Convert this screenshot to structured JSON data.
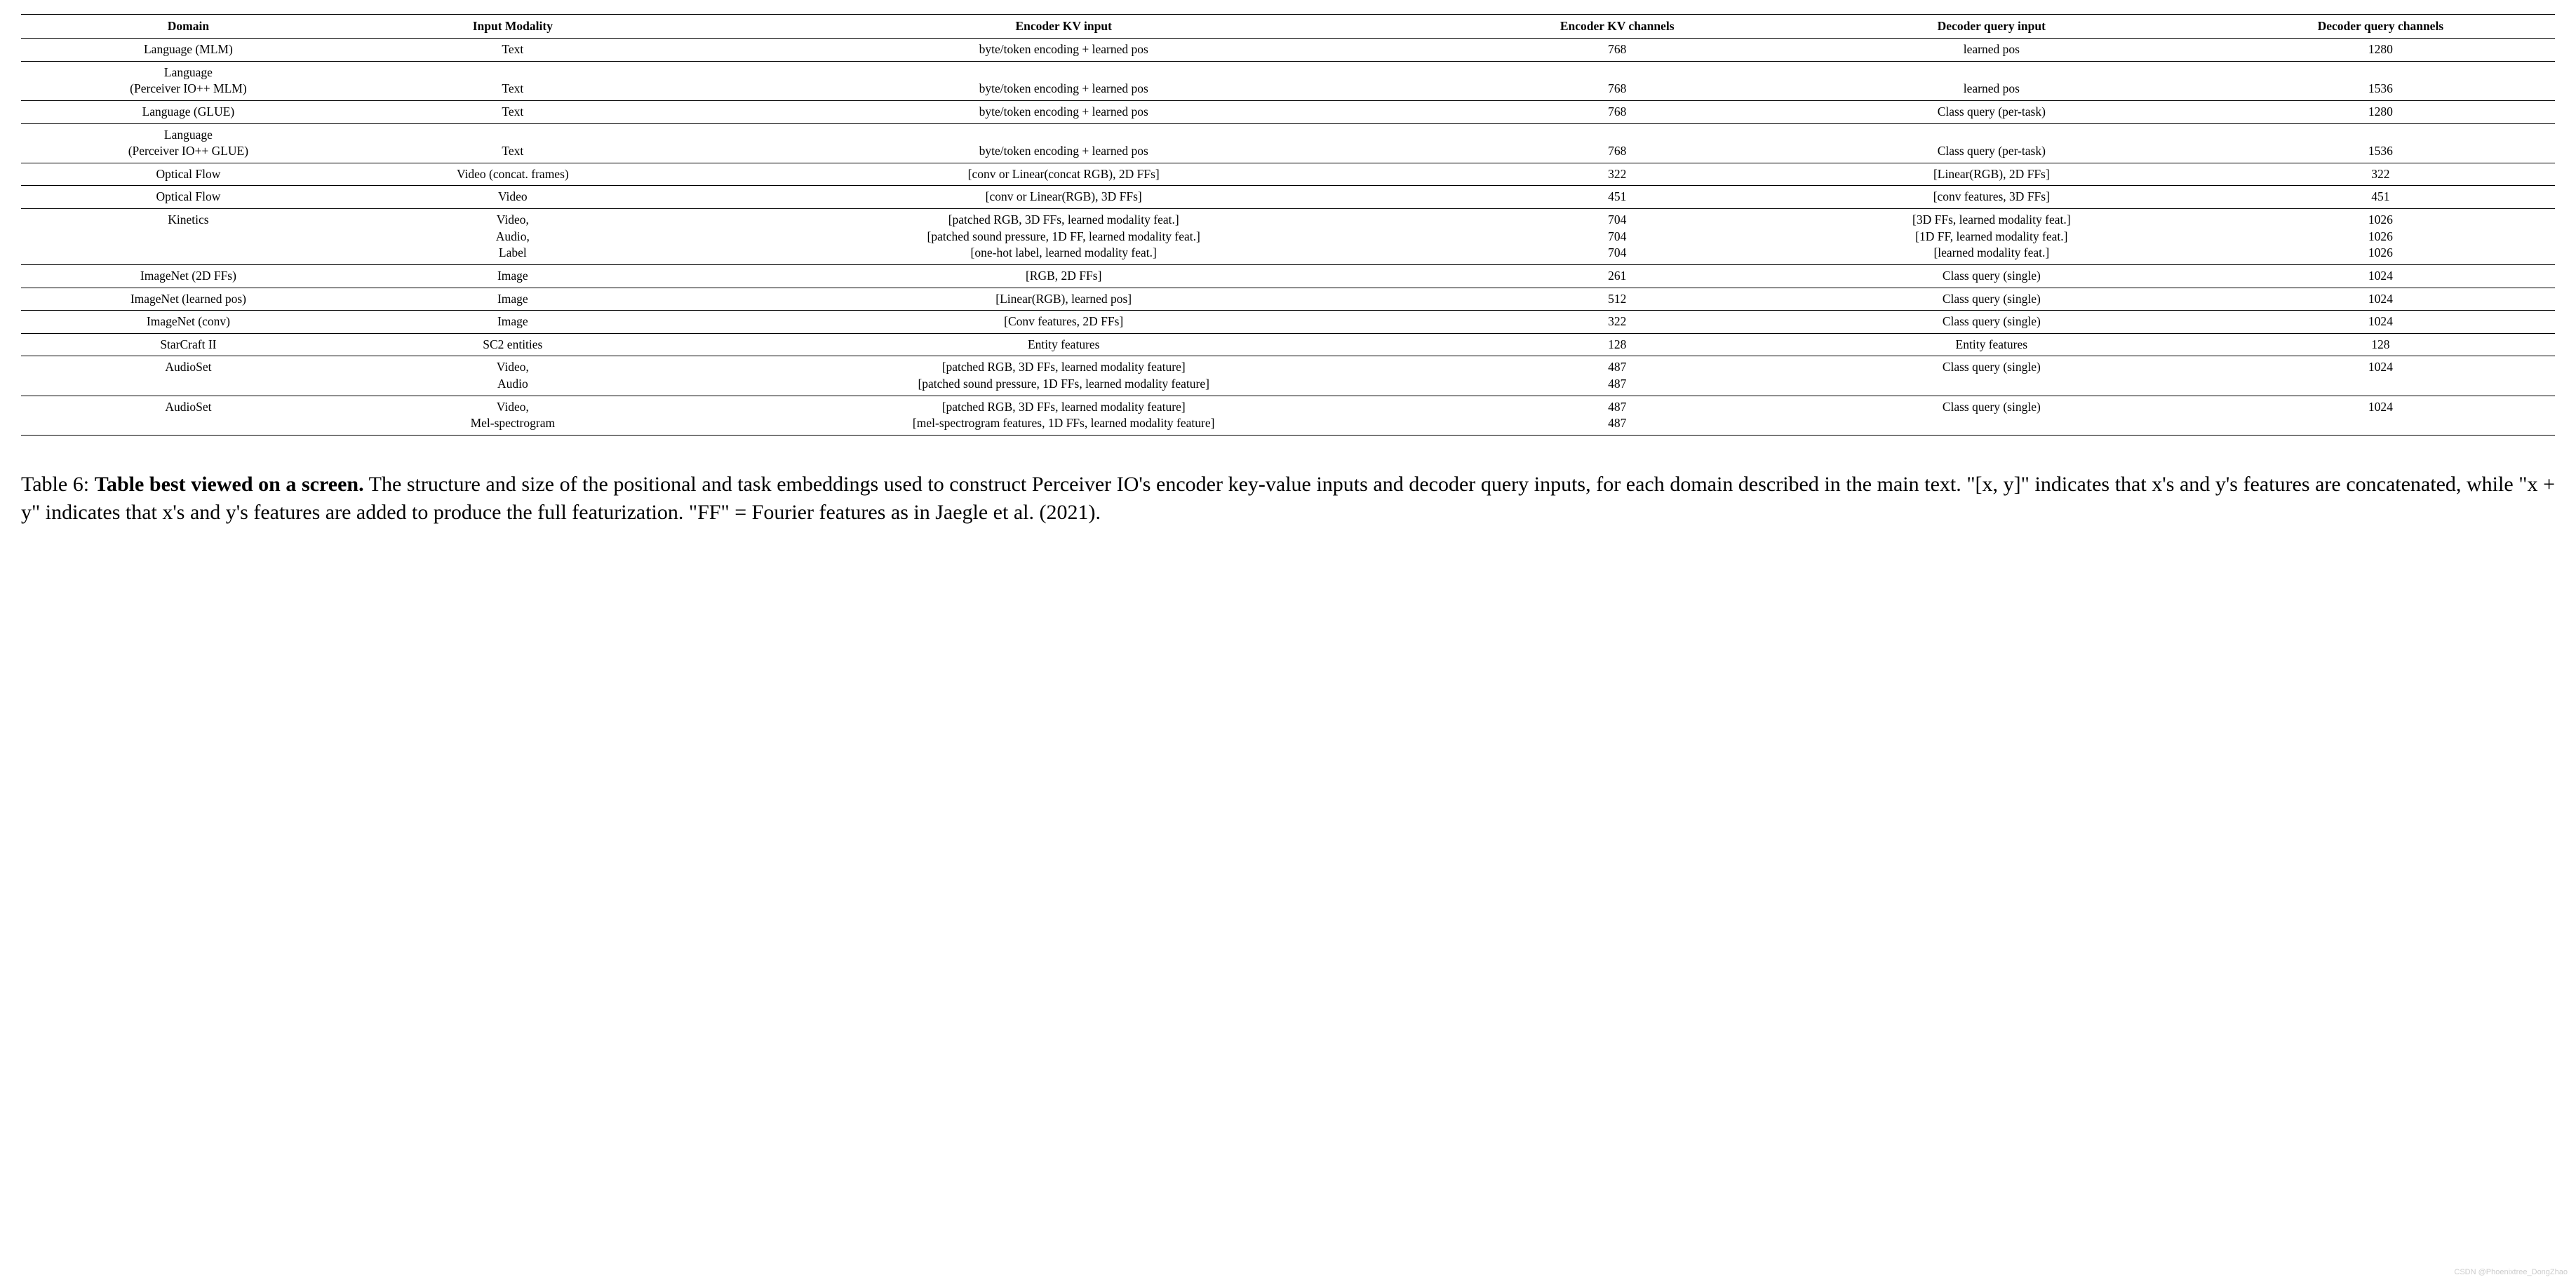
{
  "headers": {
    "domain": "Domain",
    "input_modality": "Input Modality",
    "encoder_kv_input": "Encoder KV input",
    "encoder_kv_channels": "Encoder KV channels",
    "decoder_query_input": "Decoder query input",
    "decoder_query_channels": "Decoder query channels"
  },
  "rows": {
    "r1": {
      "domain": "Language (MLM)",
      "input_modality": "Text",
      "encoder_kv_input": "byte/token encoding + learned pos",
      "encoder_kv_channels": "768",
      "decoder_query_input": "learned pos",
      "decoder_query_channels": "1280"
    },
    "r2": {
      "domain_l1": "Language",
      "domain_l2": "(Perceiver IO++ MLM)",
      "input_modality": "Text",
      "encoder_kv_input": "byte/token encoding + learned pos",
      "encoder_kv_channels": "768",
      "decoder_query_input": "learned pos",
      "decoder_query_channels": "1536"
    },
    "r3": {
      "domain": "Language (GLUE)",
      "input_modality": "Text",
      "encoder_kv_input": "byte/token encoding + learned pos",
      "encoder_kv_channels": "768",
      "decoder_query_input": "Class query (per-task)",
      "decoder_query_channels": "1280"
    },
    "r4": {
      "domain_l1": "Language",
      "domain_l2": "(Perceiver IO++ GLUE)",
      "input_modality": "Text",
      "encoder_kv_input": "byte/token encoding + learned pos",
      "encoder_kv_channels": "768",
      "decoder_query_input": "Class query (per-task)",
      "decoder_query_channels": "1536"
    },
    "r5": {
      "domain": "Optical Flow",
      "input_modality": "Video (concat. frames)",
      "encoder_kv_input": "[conv or Linear(concat RGB), 2D FFs]",
      "encoder_kv_channels": "322",
      "decoder_query_input": "[Linear(RGB), 2D FFs]",
      "decoder_query_channels": "322"
    },
    "r6": {
      "domain": "Optical Flow",
      "input_modality": "Video",
      "encoder_kv_input": "[conv or Linear(RGB), 3D FFs]",
      "encoder_kv_channels": "451",
      "decoder_query_input": "[conv features, 3D FFs]",
      "decoder_query_channels": "451"
    },
    "r7": {
      "domain": "Kinetics",
      "im_l1": "Video,",
      "im_l2": "Audio,",
      "im_l3": "Label",
      "ekv_l1": "[patched RGB, 3D FFs, learned modality feat.]",
      "ekv_l2": "[patched sound pressure, 1D FF, learned modality feat.]",
      "ekv_l3": "[one-hot label, learned modality feat.]",
      "ekc_l1": "704",
      "ekc_l2": "704",
      "ekc_l3": "704",
      "dq_l1": "[3D FFs, learned modality feat.]",
      "dq_l2": "[1D FF, learned modality feat.]",
      "dq_l3": "[learned modality feat.]",
      "dqc_l1": "1026",
      "dqc_l2": "1026",
      "dqc_l3": "1026"
    },
    "r8": {
      "domain": "ImageNet (2D FFs)",
      "input_modality": "Image",
      "encoder_kv_input": "[RGB, 2D FFs]",
      "encoder_kv_channels": "261",
      "decoder_query_input": "Class query (single)",
      "decoder_query_channels": "1024"
    },
    "r9": {
      "domain": "ImageNet (learned pos)",
      "input_modality": "Image",
      "encoder_kv_input": "[Linear(RGB), learned pos]",
      "encoder_kv_channels": "512",
      "decoder_query_input": "Class query (single)",
      "decoder_query_channels": "1024"
    },
    "r10": {
      "domain": "ImageNet (conv)",
      "input_modality": "Image",
      "encoder_kv_input": "[Conv features, 2D FFs]",
      "encoder_kv_channels": "322",
      "decoder_query_input": "Class query (single)",
      "decoder_query_channels": "1024"
    },
    "r11": {
      "domain": "StarCraft II",
      "input_modality": "SC2 entities",
      "encoder_kv_input": "Entity features",
      "encoder_kv_channels": "128",
      "decoder_query_input": "Entity features",
      "decoder_query_channels": "128"
    },
    "r12": {
      "domain": "AudioSet",
      "im_l1": "Video,",
      "im_l2": "Audio",
      "ekv_l1": "[patched RGB, 3D FFs, learned modality feature]",
      "ekv_l2": "[patched sound pressure, 1D FFs, learned modality feature]",
      "ekc_l1": "487",
      "ekc_l2": "487",
      "decoder_query_input": "Class query (single)",
      "decoder_query_channels": "1024"
    },
    "r13": {
      "domain": "AudioSet",
      "im_l1": "Video,",
      "im_l2": "Mel-spectrogram",
      "ekv_l1": "[patched RGB, 3D FFs, learned modality feature]",
      "ekv_l2": "[mel-spectrogram features, 1D FFs, learned modality feature]",
      "ekc_l1": "487",
      "ekc_l2": "487",
      "decoder_query_input": "Class query (single)",
      "decoder_query_channels": "1024"
    }
  },
  "caption": {
    "label": "Table 6: ",
    "bold": "Table best viewed on a screen.",
    "rest": " The structure and size of the positional and task embeddings used to construct Perceiver IO's encoder key-value inputs and decoder query inputs, for each domain described in the main text. \"[x, y]\" indicates that x's and y's features are concatenated, while \"x + y\" indicates that x's and y's features are added to produce the full featurization. \"FF\" = Fourier features as in Jaegle et al. (2021)."
  },
  "watermark": "CSDN @Phoenixtree_DongZhao"
}
